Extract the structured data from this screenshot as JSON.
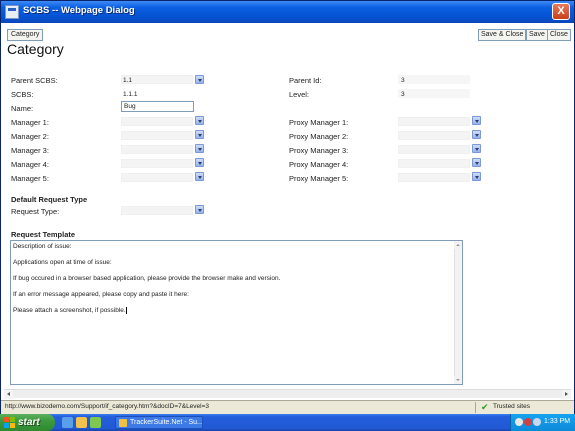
{
  "window": {
    "title": "SCBS -- Webpage Dialog",
    "close_glyph": "X"
  },
  "toolbar": {
    "tab_label": "Category",
    "save_close_label": "Save & Close",
    "save_label": "Save",
    "close_label": "Close"
  },
  "page": {
    "title": "Category"
  },
  "form": {
    "parent_scbs_label": "Parent SCBS:",
    "parent_scbs_value": "1.1",
    "scbs_label": "SCBS:",
    "scbs_value": "1.1.1",
    "name_label": "Name:",
    "name_value": "Bug",
    "parent_id_label": "Parent Id:",
    "parent_id_value": "3",
    "level_label": "Level:",
    "level_value": "3",
    "managers": [
      {
        "label": "Manager 1:"
      },
      {
        "label": "Manager 2:"
      },
      {
        "label": "Manager 3:"
      },
      {
        "label": "Manager 4:"
      },
      {
        "label": "Manager 5:"
      }
    ],
    "proxy_managers": [
      {
        "label": "Proxy Manager 1:"
      },
      {
        "label": "Proxy Manager 2:"
      },
      {
        "label": "Proxy Manager 3:"
      },
      {
        "label": "Proxy Manager 4:"
      },
      {
        "label": "Proxy Manager 5:"
      }
    ],
    "default_request_type_heading": "Default Request Type",
    "request_type_label": "Request Type:",
    "request_template_heading": "Request Template",
    "template_lines": [
      "Description of issue:",
      "Applications open at time of issue:",
      "If bug occured in a browser based application, please provide the browser make and version.",
      "If an error message appeared, please copy and paste it here:",
      "Please attach a screenshot, if possible."
    ]
  },
  "statusbar": {
    "url": "http://www.bizodemo.com/Support/if_category.htm?&docID=7&Level=3",
    "zone": "Trusted sites"
  },
  "taskbar": {
    "start_label": "start",
    "task_label": "TrackerSuite.Net - Su...",
    "clock": "1:33 PM"
  },
  "colors": {
    "titlebar": "#0553d4",
    "taskbar": "#245edb",
    "start": "#3c993c"
  },
  "icons": {
    "window_app": "app-icon",
    "zone": "checkmark-icon"
  }
}
